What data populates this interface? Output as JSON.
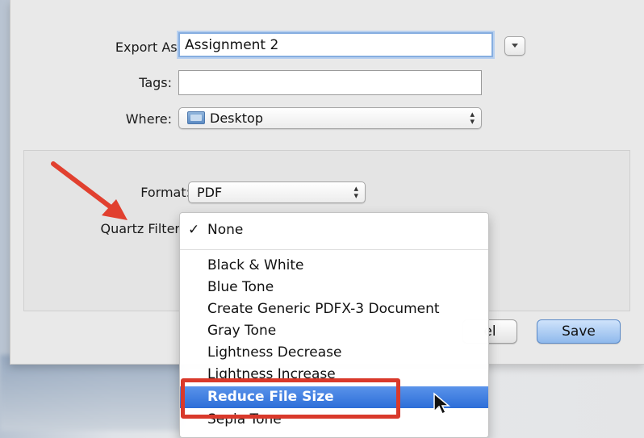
{
  "dialog": {
    "export_as_label": "Export As:",
    "export_as_value": "Assignment 2",
    "tags_label": "Tags:",
    "tags_value": "",
    "where_label": "Where:",
    "where_value": "Desktop",
    "format_label": "Format:",
    "format_value": "PDF",
    "quartz_filter_label": "Quartz Filter",
    "cancel_label": "el",
    "save_label": "Save"
  },
  "quartz_menu": {
    "items": [
      {
        "label": "None",
        "checked": true
      },
      {
        "label": "Black & White"
      },
      {
        "label": "Blue Tone"
      },
      {
        "label": "Create Generic PDFX-3 Document"
      },
      {
        "label": "Gray Tone"
      },
      {
        "label": "Lightness Decrease"
      },
      {
        "label": "Lightness Increase"
      },
      {
        "label": "Reduce File Size",
        "highlighted": true
      },
      {
        "label": "Sepia Tone"
      }
    ]
  },
  "icons": {
    "folder": "folder-icon",
    "disclosure": "chevron-down-icon",
    "annotation": "red-arrow-icon",
    "pointer": "mouse-pointer-icon",
    "check": "checkmark-icon"
  },
  "colors": {
    "menu_highlight": "#2d6ed8",
    "annotation_red": "#d9392b",
    "focus_ring": "#86aee0"
  }
}
